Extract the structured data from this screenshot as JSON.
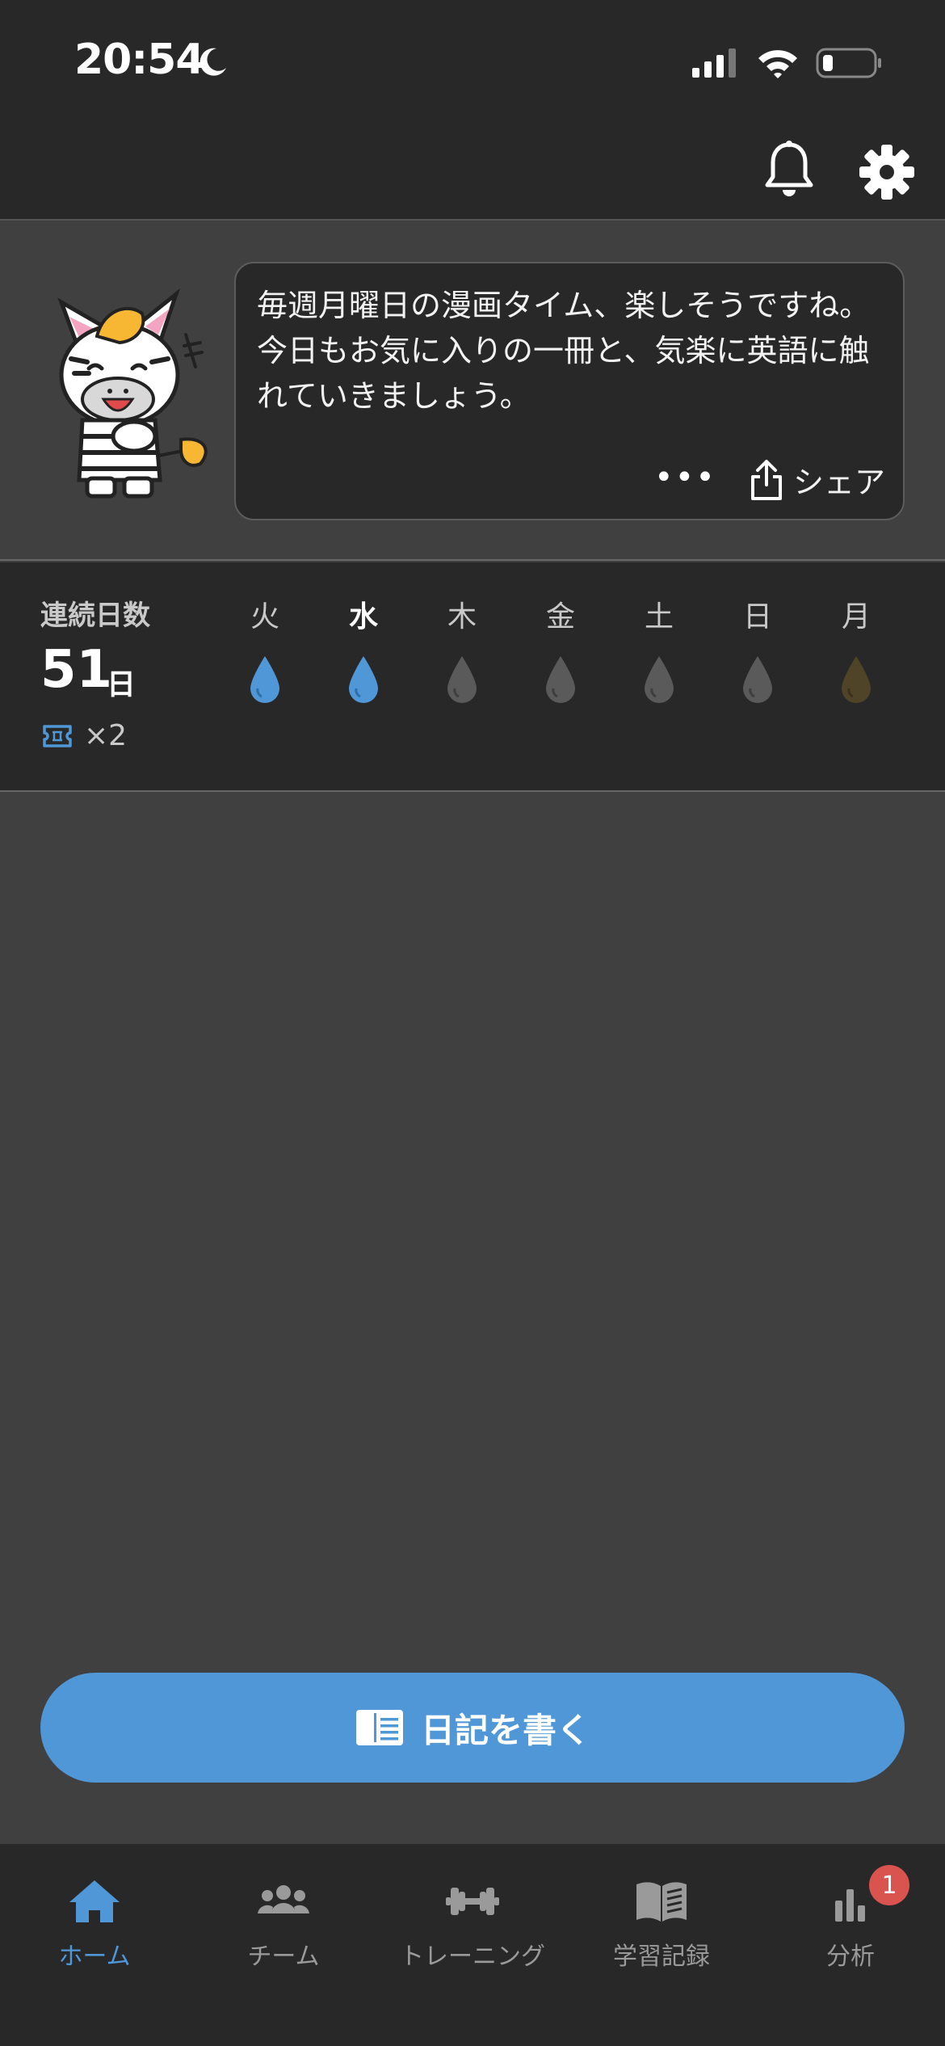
{
  "status_bar": {
    "time": "20:54"
  },
  "message": {
    "text": "毎週月曜日の漫画タイム、楽しそうですね。今日もお気に入りの一冊と、気楽に英語に触れていきましょう。",
    "more_label": "•••",
    "share_label": "シェア"
  },
  "streak": {
    "label": "連続日数",
    "count": "51",
    "unit": "日",
    "tickets": "×2",
    "days": [
      {
        "label": "火",
        "state": "done",
        "color": "#4f97d6"
      },
      {
        "label": "水",
        "state": "today-done",
        "color": "#4f97d6"
      },
      {
        "label": "木",
        "state": "pending",
        "color": "#5a5a5a"
      },
      {
        "label": "金",
        "state": "pending",
        "color": "#5a5a5a"
      },
      {
        "label": "土",
        "state": "pending",
        "color": "#5a5a5a"
      },
      {
        "label": "日",
        "state": "pending",
        "color": "#5a5a5a"
      },
      {
        "label": "月",
        "state": "bonus",
        "color": "#4f4427"
      }
    ]
  },
  "write_button": {
    "label": "日記を書く"
  },
  "tabs": [
    {
      "label": "ホーム",
      "icon": "home-icon",
      "active": true
    },
    {
      "label": "チーム",
      "icon": "team-icon",
      "active": false
    },
    {
      "label": "トレーニング",
      "icon": "dumbbell-icon",
      "active": false
    },
    {
      "label": "学習記録",
      "icon": "book-icon",
      "active": false
    },
    {
      "label": "分析",
      "icon": "chart-icon",
      "active": false,
      "badge": "1"
    }
  ],
  "colors": {
    "accent": "#4f97d6",
    "badge": "#d9534f",
    "background": "#404040",
    "panel": "#282828"
  }
}
